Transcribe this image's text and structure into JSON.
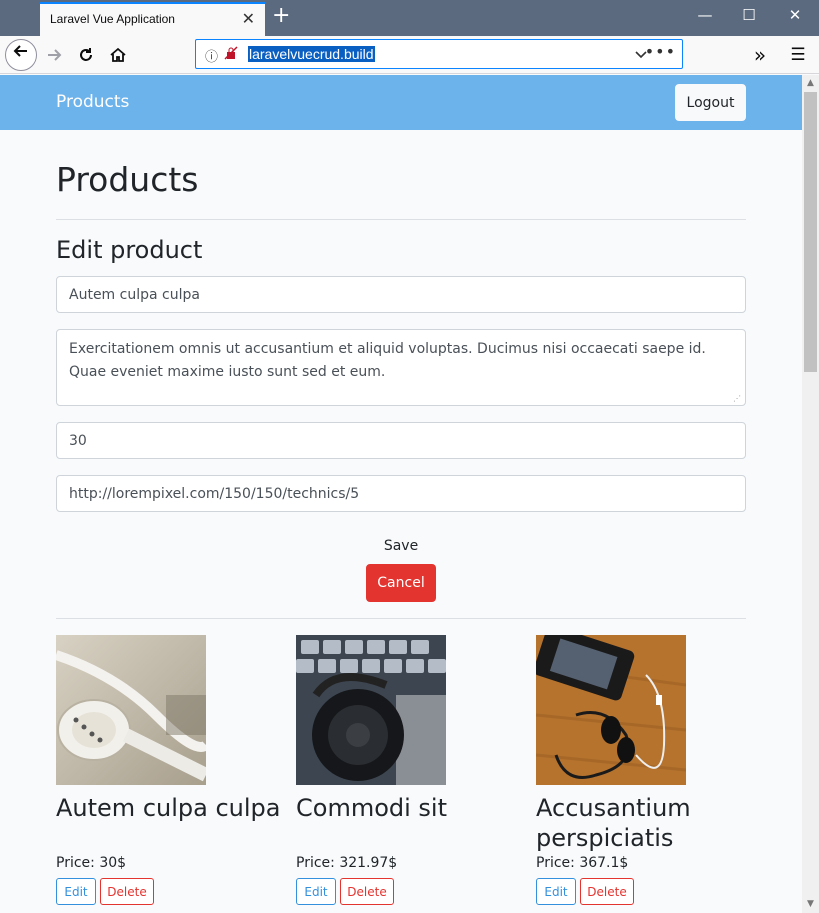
{
  "browser": {
    "tab_title": "Laravel Vue Application",
    "tab_close": "✕",
    "new_tab": "+",
    "url": "laravelvuecrud.build",
    "window_controls": {
      "minimize": "—",
      "maximize": "☐",
      "close": "✕"
    },
    "overflow_icon": "»",
    "menu_icon": "☰",
    "icons": [
      "back-icon",
      "forward-icon",
      "reload-icon",
      "home-icon",
      "info-icon",
      "tracking-icon",
      "dropdown-icon",
      "page-actions-icon"
    ]
  },
  "navbar": {
    "brand": "Products",
    "logout_label": "Logout",
    "color": "#6cb2eb"
  },
  "page": {
    "title": "Products",
    "form_title": "Edit product"
  },
  "form": {
    "name": "Autem culpa culpa",
    "description": "Exercitationem omnis ut accusantium et aliquid voluptas. Ducimus nisi occaecati saepe id. Quae eveniet maxime iusto sunt sed et eum.",
    "price": "30",
    "image": "http://lorempixel.com/150/150/technics/5",
    "save_label": "Save",
    "cancel_label": "Cancel",
    "cancel_color": "#e3342f"
  },
  "products": [
    {
      "name": "Autem culpa culpa",
      "price": "Price: 30$",
      "edit_label": "Edit",
      "delete_label": "Delete",
      "image_icon": "earbuds-image"
    },
    {
      "name": "Commodi sit",
      "price": "Price: 321.97$",
      "edit_label": "Edit",
      "delete_label": "Delete",
      "image_icon": "headphones-image"
    },
    {
      "name": "Accusantium perspiciatis",
      "price": "Price: 367.1$",
      "edit_label": "Edit",
      "delete_label": "Delete",
      "image_icon": "earphones-phone-image"
    }
  ]
}
